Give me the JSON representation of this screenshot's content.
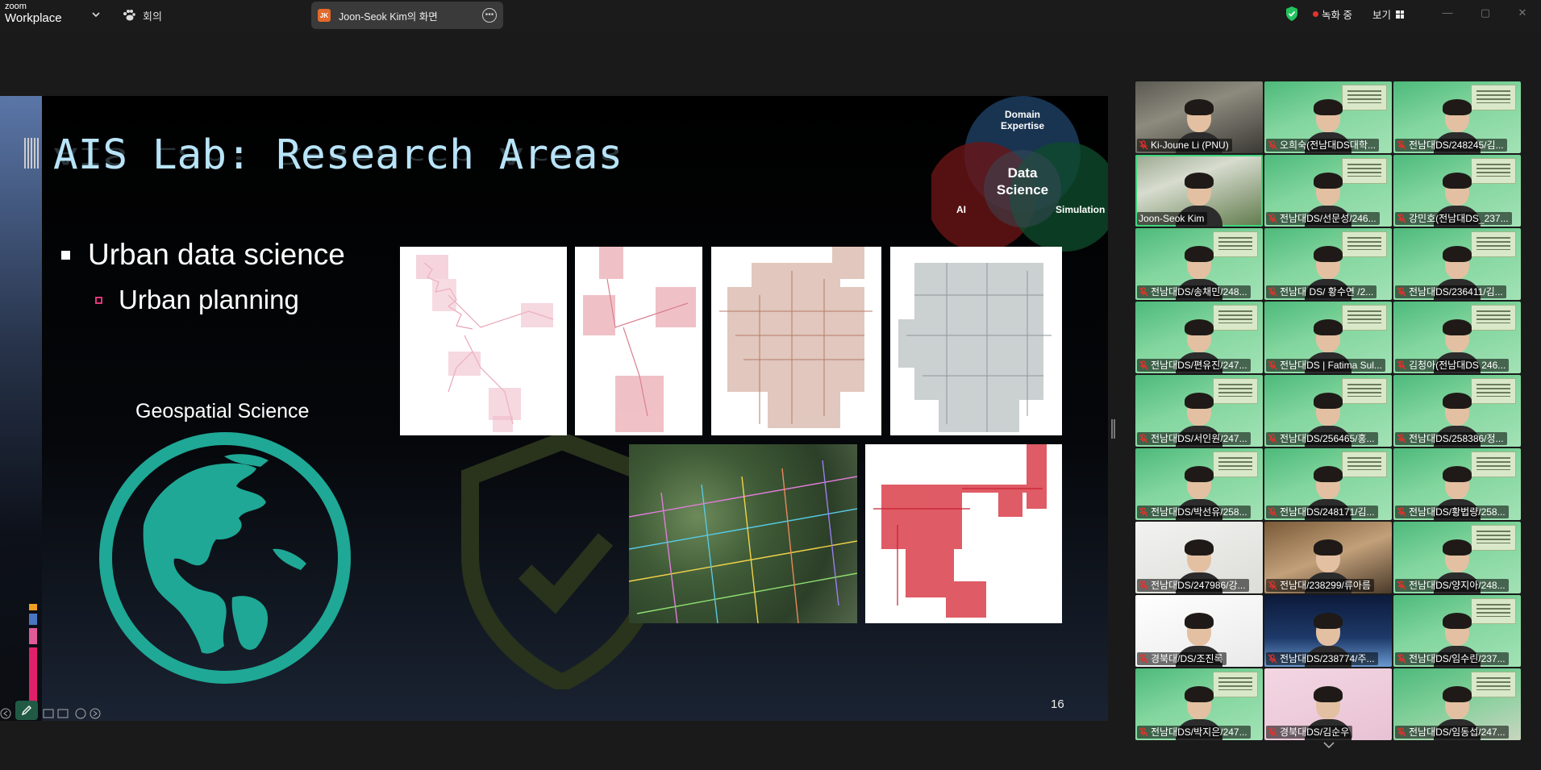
{
  "app": {
    "logo_small": "zoom",
    "logo_big": "Workplace",
    "meeting_label": "회의",
    "share_label": "Joon-Seok Kim의 화면",
    "share_initials": "JK",
    "recording_label": "녹화 중",
    "view_label": "보기"
  },
  "slide": {
    "title": "AIS Lab: Research Areas",
    "bullet1": "Urban data science",
    "bullet2": "Urban planning",
    "geo_label": "Geospatial Science",
    "venn": {
      "domain": "Domain Expertise",
      "domain_l1": "Domain",
      "domain_l2": "Expertise",
      "center_l1": "Data",
      "center_l2": "Science",
      "ai": "AI",
      "sim": "Simulation"
    },
    "page_number": "16"
  },
  "participants": [
    {
      "name": "Ki-Joune Li (PNU)",
      "muted": true,
      "kind": "office"
    },
    {
      "name": "오희숙(전남대DS대학...",
      "muted": true,
      "kind": "green"
    },
    {
      "name": "전남대DS/248245/김...",
      "muted": true,
      "kind": "green"
    },
    {
      "name": "Joon-Seok Kim",
      "muted": false,
      "kind": "campus",
      "active": true
    },
    {
      "name": "전남대DS/선문성/246...",
      "muted": true,
      "kind": "green"
    },
    {
      "name": "강민호(전남대DS_237...",
      "muted": true,
      "kind": "green"
    },
    {
      "name": "전남대DS/송채민/248...",
      "muted": true,
      "kind": "green"
    },
    {
      "name": "전남대 DS/ 황수연 /2...",
      "muted": true,
      "kind": "green"
    },
    {
      "name": "전남대DS/236411/김...",
      "muted": true,
      "kind": "green"
    },
    {
      "name": "전남대DS/편유진/247...",
      "muted": true,
      "kind": "green"
    },
    {
      "name": "전남대DS | Fatima Sul...",
      "muted": true,
      "kind": "green"
    },
    {
      "name": "김청아(전남대DS 246...",
      "muted": true,
      "kind": "green"
    },
    {
      "name": "전남대DS/서인원/247...",
      "muted": true,
      "kind": "green"
    },
    {
      "name": "전남대DS/256465/홍...",
      "muted": true,
      "kind": "green"
    },
    {
      "name": "전남대DS/258386/정...",
      "muted": true,
      "kind": "green"
    },
    {
      "name": "전남대DS/박선유/258...",
      "muted": true,
      "kind": "green"
    },
    {
      "name": "전남대DS/248171/김...",
      "muted": true,
      "kind": "green"
    },
    {
      "name": "전남대DS/황법량/258...",
      "muted": true,
      "kind": "green"
    },
    {
      "name": "전남대DS/247986/강...",
      "muted": true,
      "kind": "white"
    },
    {
      "name": "전남대/238299/류아름",
      "muted": true,
      "kind": "room"
    },
    {
      "name": "전남대DS/양지아/248...",
      "muted": true,
      "kind": "green"
    },
    {
      "name": "경북대/DS/조진록",
      "muted": true,
      "kind": "knu"
    },
    {
      "name": "전남대DS/238774/주...",
      "muted": true,
      "kind": "earth"
    },
    {
      "name": "전남대DS/임수린/237...",
      "muted": true,
      "kind": "green"
    },
    {
      "name": "전남대DS/박지은/247...",
      "muted": true,
      "kind": "green"
    },
    {
      "name": "경북대DS/김순우",
      "muted": true,
      "kind": "knu2"
    },
    {
      "name": "전남대DS/임동섭/247...",
      "muted": true,
      "kind": "greenoffice"
    }
  ],
  "colors": {
    "title": "#b8e4f8",
    "teal": "#1fa896",
    "bullet_pink": "#e3347a",
    "active_border": "#3ed57d",
    "rec_red": "#e5312b"
  },
  "icons": [
    "chevron-down-icon",
    "paw-icon",
    "more-icon",
    "shield-check-icon",
    "record-dot-icon",
    "grid-icon",
    "minimize-icon",
    "maximize-icon",
    "close-icon",
    "globe-icon",
    "shield-check-large-icon",
    "pen-icon",
    "mic-off-icon",
    "chevron-down-scroll-icon"
  ]
}
